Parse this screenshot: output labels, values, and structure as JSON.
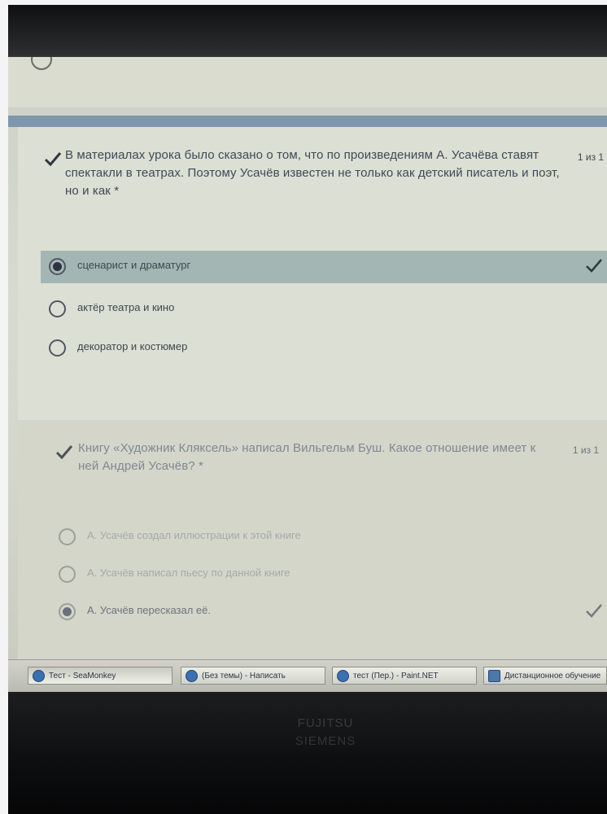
{
  "question1": {
    "text": "В материалах урока было сказано о том, что по произведениям А. Усачёва ставят спектакли в театрах. Поэтому Усачёв известен не только как детский писатель и поэт, но и как *",
    "points": "1 из 1",
    "options": [
      {
        "label": "сценарист и драматург",
        "selected": true,
        "correct": true
      },
      {
        "label": "актёр театра и кино",
        "selected": false
      },
      {
        "label": "декоратор и костюмер",
        "selected": false
      }
    ]
  },
  "question2": {
    "text": "Книгу «Художник Кляксель» написал Вильгельм Буш. Какое отношение имеет к ней Андрей Усачёв? *",
    "points": "1 из 1",
    "options": [
      {
        "label": "А. Усачёв создал иллюстрации к этой книге",
        "selected": false
      },
      {
        "label": "А. Усачёв написал пьесу по данной книге",
        "selected": false
      },
      {
        "label": "А. Усачёв пересказал её.",
        "selected": true,
        "correct": true
      }
    ]
  },
  "taskbar": {
    "items": [
      {
        "label": "Тест - SeaMonkey",
        "icon": "seamonkey-icon"
      },
      {
        "label": "(Без темы) - Написать",
        "icon": "compose-icon"
      },
      {
        "label": "тест (Пер.) - Paint.NET",
        "icon": "paint-icon"
      },
      {
        "label": "Дистанционное обучение",
        "icon": "window-icon"
      }
    ]
  },
  "device": {
    "brand_line1": "FUJITSU",
    "brand_line2": "SIEMENS"
  },
  "colors": {
    "section_bar": "#7f97ad",
    "selected_option": "#a4b6b3"
  }
}
